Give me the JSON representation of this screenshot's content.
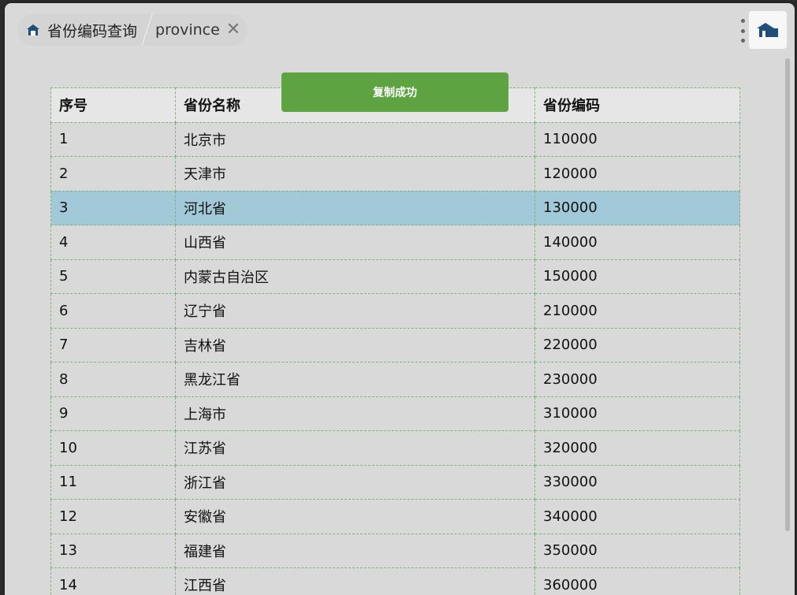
{
  "tab": {
    "title": "省份编码查询",
    "query": "province",
    "close_glyph": "✕"
  },
  "toast": {
    "message": "复制成功"
  },
  "table": {
    "headers": [
      "序号",
      "省份名称",
      "省份编码"
    ],
    "selected_row": 3,
    "rows": [
      [
        "1",
        "北京市",
        "110000"
      ],
      [
        "2",
        "天津市",
        "120000"
      ],
      [
        "3",
        "河北省",
        "130000"
      ],
      [
        "4",
        "山西省",
        "140000"
      ],
      [
        "5",
        "内蒙古自治区",
        "150000"
      ],
      [
        "6",
        "辽宁省",
        "210000"
      ],
      [
        "7",
        "吉林省",
        "220000"
      ],
      [
        "8",
        "黑龙江省",
        "230000"
      ],
      [
        "9",
        "上海市",
        "310000"
      ],
      [
        "10",
        "江苏省",
        "320000"
      ],
      [
        "11",
        "浙江省",
        "330000"
      ],
      [
        "12",
        "安徽省",
        "340000"
      ],
      [
        "13",
        "福建省",
        "350000"
      ],
      [
        "14",
        "江西省",
        "360000"
      ]
    ]
  },
  "icons": {
    "tab_icon": "house-icon",
    "menu": "more-vertical-icon",
    "logo": "province-logo-icon"
  },
  "colors": {
    "toast_bg": "#5da342",
    "selected_row_bg": "#a2c9d8",
    "grid_border": "#7fb27f"
  }
}
